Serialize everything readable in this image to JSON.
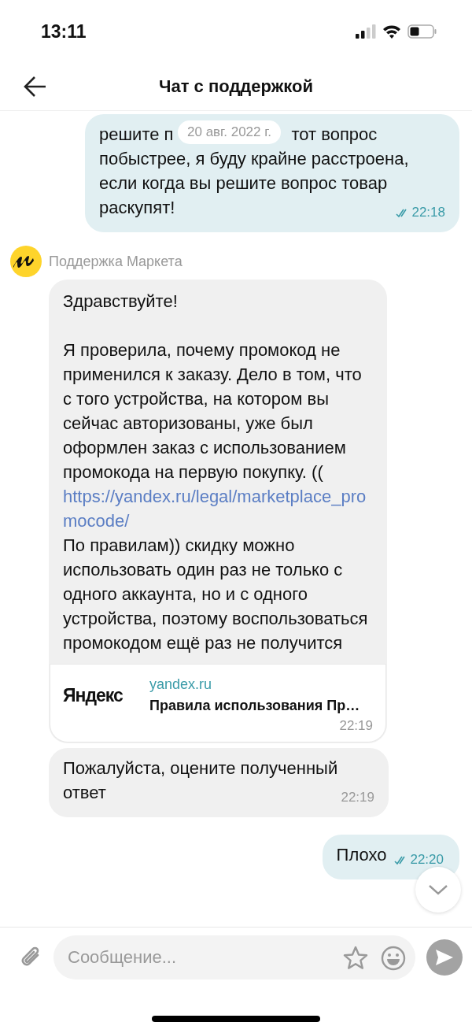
{
  "status_bar": {
    "time": "13:11"
  },
  "header": {
    "title": "Чат с поддержкой"
  },
  "date_pill": "20 авг. 2022 г.",
  "messages": [
    {
      "kind": "outgoing",
      "text_before_pill": "решите п",
      "text_after_pill": "тот вопрос",
      "text": "побыстрее, я буду крайне расстроена, если когда вы решите вопрос товар раскупят!",
      "time": "22:18",
      "read": true
    },
    {
      "kind": "sender",
      "name": "Поддержка Маркета"
    },
    {
      "kind": "incoming",
      "text": "Здравствуйте!\n\nЯ проверила, почему промокод не применился к заказу. Дело в том, что с того устройства, на котором вы сейчас авторизованы, уже был оформлен заказ с использованием промокода на первую покупку. ((",
      "link": "https://yandex.ru/legal/marketplace_promocode/",
      "text_after": " По правилам)) скидку можно использовать один раз не только с одного аккаунта, но и с одного устройства, поэтому воспользоваться промокодом ещё раз не получится",
      "preview": {
        "logo": "Яндекс",
        "domain": "yandex.ru",
        "title": "Правила использования Пр…",
        "time": "22:19"
      }
    },
    {
      "kind": "incoming",
      "text": "Пожалуйста, оцените полученный ответ",
      "time": "22:19"
    },
    {
      "kind": "outgoing",
      "text": "Плохо",
      "time": "22:20",
      "read": true
    }
  ],
  "composer": {
    "placeholder": "Сообщение..."
  }
}
